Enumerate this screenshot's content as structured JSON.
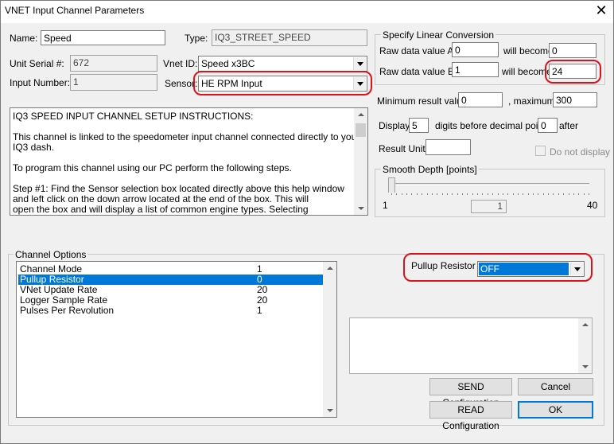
{
  "window": {
    "title": "VNET Input Channel Parameters",
    "close_glyph": "✕"
  },
  "fields": {
    "name_label": "Name:",
    "name_value": "Speed",
    "type_label": "Type:",
    "type_value": "IQ3_STREET_SPEED",
    "serial_label": "Unit Serial #:",
    "serial_value": "672",
    "vnet_id_label": "Vnet ID:",
    "vnet_id_value": "Speed  x3BC",
    "input_number_label": "Input Number:",
    "input_number_value": "1",
    "sensor_label": "Sensor:",
    "sensor_value": "HE RPM Input"
  },
  "instructions": {
    "lines": [
      "IQ3 SPEED INPUT CHANNEL SETUP INSTRUCTIONS:",
      "",
      "This channel is linked to the speedometer input channel connected directly to your",
      "IQ3 dash.",
      "",
      "To program this channel using our PC perform the following steps.",
      "",
      "Step #1:   Find the Sensor selection box located directly above this help window",
      "               and left click on the down arrow located at the end of the box.  This will",
      "               open the box and will display a list of common engine types.  Selecting"
    ]
  },
  "linear": {
    "group_title": "Specify Linear Conversion",
    "raw_a_label": "Raw data value A:",
    "raw_a_value": "0",
    "will_become_a": "will become",
    "result_a_value": "0",
    "raw_b_label": "Raw data value B:",
    "raw_b_value": "1",
    "will_become_b": "will become",
    "result_b_value": "24"
  },
  "result": {
    "min_label": "Minimum result value:",
    "min_value": "0",
    "max_label": ", maximum:",
    "max_value": "300",
    "display_label": "Display:",
    "display_value": "5",
    "digits_label": "digits before decimal point,",
    "after_value": "0",
    "after_label": "after",
    "unit_label": "Result Unit:",
    "unit_value": "",
    "do_not_display_label": "Do not display"
  },
  "smooth": {
    "group_title": "Smooth Depth [points]",
    "min_label": "1",
    "max_label": "40",
    "current_label": "1",
    "level": 1
  },
  "channel_options": {
    "group_title": "Channel Options",
    "rows": [
      {
        "name": "Channel Mode",
        "value": "1"
      },
      {
        "name": "Pullup Resistor",
        "value": "0"
      },
      {
        "name": "VNet Update Rate",
        "value": "20"
      },
      {
        "name": "Logger Sample Rate",
        "value": "20"
      },
      {
        "name": "Pulses Per Revolution",
        "value": "1"
      }
    ],
    "selected_index": 1,
    "pullup_label": "Pullup Resistor",
    "pullup_value": "OFF"
  },
  "buttons": {
    "send": "SEND Configuration",
    "cancel": "Cancel",
    "read": "READ Configuration",
    "ok": "OK"
  },
  "colors": {
    "highlight": "#e0101a",
    "selection": "#0078d7"
  }
}
